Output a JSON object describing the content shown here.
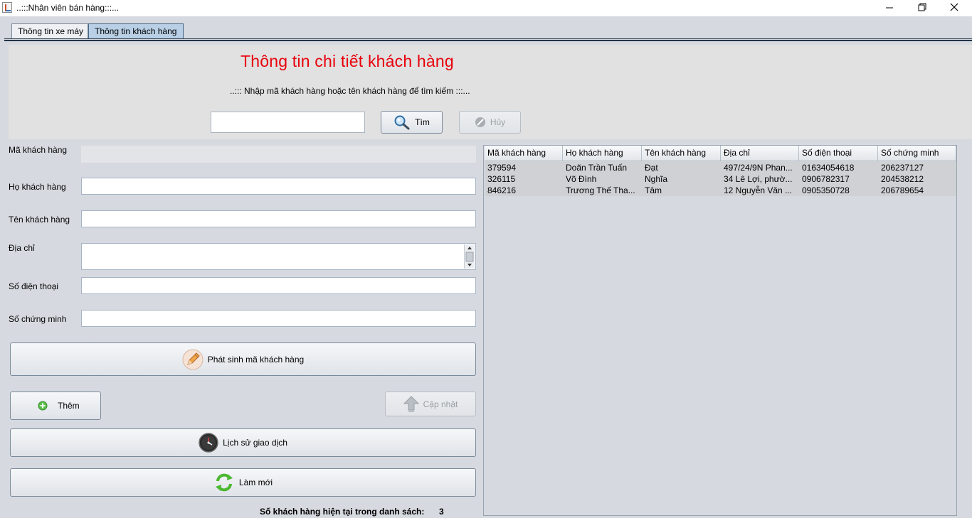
{
  "window": {
    "title": "..:::Nhân viên bán hàng:::..."
  },
  "tabs": [
    {
      "label": "Thông tin xe máy",
      "active": false
    },
    {
      "label": "Thông tin khách hàng",
      "active": true
    }
  ],
  "header": {
    "title": "Thông tin chi tiết khách hàng",
    "search_hint": "..::: Nhập mã khách hàng hoặc tên khách hàng để tìm kiếm :::...",
    "search_value": "",
    "search_button": "Tìm",
    "cancel_button": "Hủy"
  },
  "form": {
    "ma_label": "Mã khách hàng",
    "ho_label": "Họ khách hàng",
    "ten_label": "Tên khách hàng",
    "diachi_label": "Địa chỉ",
    "sdt_label": "Số điện thoại",
    "scm_label": "Số chứng minh",
    "ma_value": "",
    "ho_value": "",
    "ten_value": "",
    "diachi_value": "",
    "sdt_value": "",
    "scm_value": ""
  },
  "buttons": {
    "generate": "Phát sinh mã khách hàng",
    "add": "Thêm",
    "update": "Cập nhật",
    "history": "Lịch sử giao dịch",
    "refresh": "Làm mới"
  },
  "status": {
    "count_label": "Số khách hàng hiện tại trong danh sách:",
    "count_value": "3"
  },
  "table": {
    "columns": [
      "Mã khách hàng",
      "Họ khách hàng",
      "Tên khách hàng",
      "Địa chỉ",
      "Số điện thoại",
      "Số chứng minh"
    ],
    "rows": [
      [
        "379594",
        "Doãn Trần Tuấn",
        "Đạt",
        "497/24/9N Phan...",
        "01634054618",
        "206237127"
      ],
      [
        "326115",
        "Võ Đình",
        "Nghĩa",
        "34 Lê Lợi, phườ...",
        "0906782317",
        "204538212"
      ],
      [
        "846216",
        "Trương Thế Tha...",
        "Tâm",
        "12 Nguyễn Văn ...",
        "0905350728",
        "206789654"
      ]
    ]
  },
  "colors": {
    "title_red": "#e8000b",
    "panel_bg": "#d6d9df",
    "header_bg": "#e1e1e1",
    "row_bg": "#cfd1d4"
  }
}
